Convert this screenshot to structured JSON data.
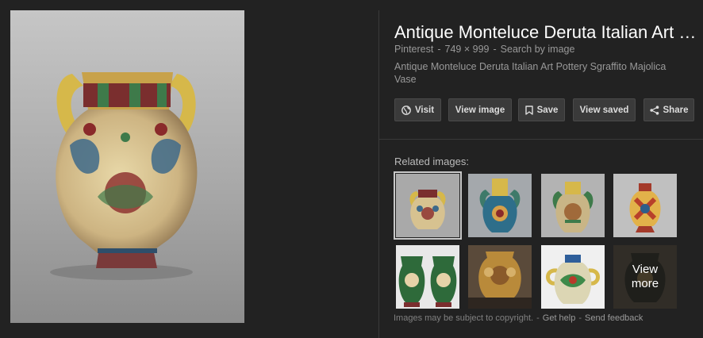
{
  "preview": {
    "image_alt": "Antique Monteluce Deruta Italian Art Pottery Sgraffito Majolica Vase"
  },
  "details": {
    "title": "Antique Monteluce Deruta Italian Art …",
    "source": "Pinterest",
    "dimensions": "749 × 999",
    "search_by_image": "Search by image",
    "separator": "-",
    "description": "Antique Monteluce Deruta Italian Art Pottery Sgraffito Majolica Vase"
  },
  "actions": {
    "visit": "Visit",
    "view_image": "View image",
    "save": "Save",
    "view_saved": "View saved",
    "share": "Share"
  },
  "related": {
    "label": "Related images:",
    "view_more": "View\nmore"
  },
  "footer": {
    "notice": "Images may be subject to copyright.",
    "get_help": "Get help",
    "send_feedback": "Send feedback",
    "separator": "-"
  },
  "colors": {
    "background": "#222222",
    "button_bg": "#3a3a3a",
    "text_primary": "#ffffff",
    "text_secondary": "#999999"
  }
}
